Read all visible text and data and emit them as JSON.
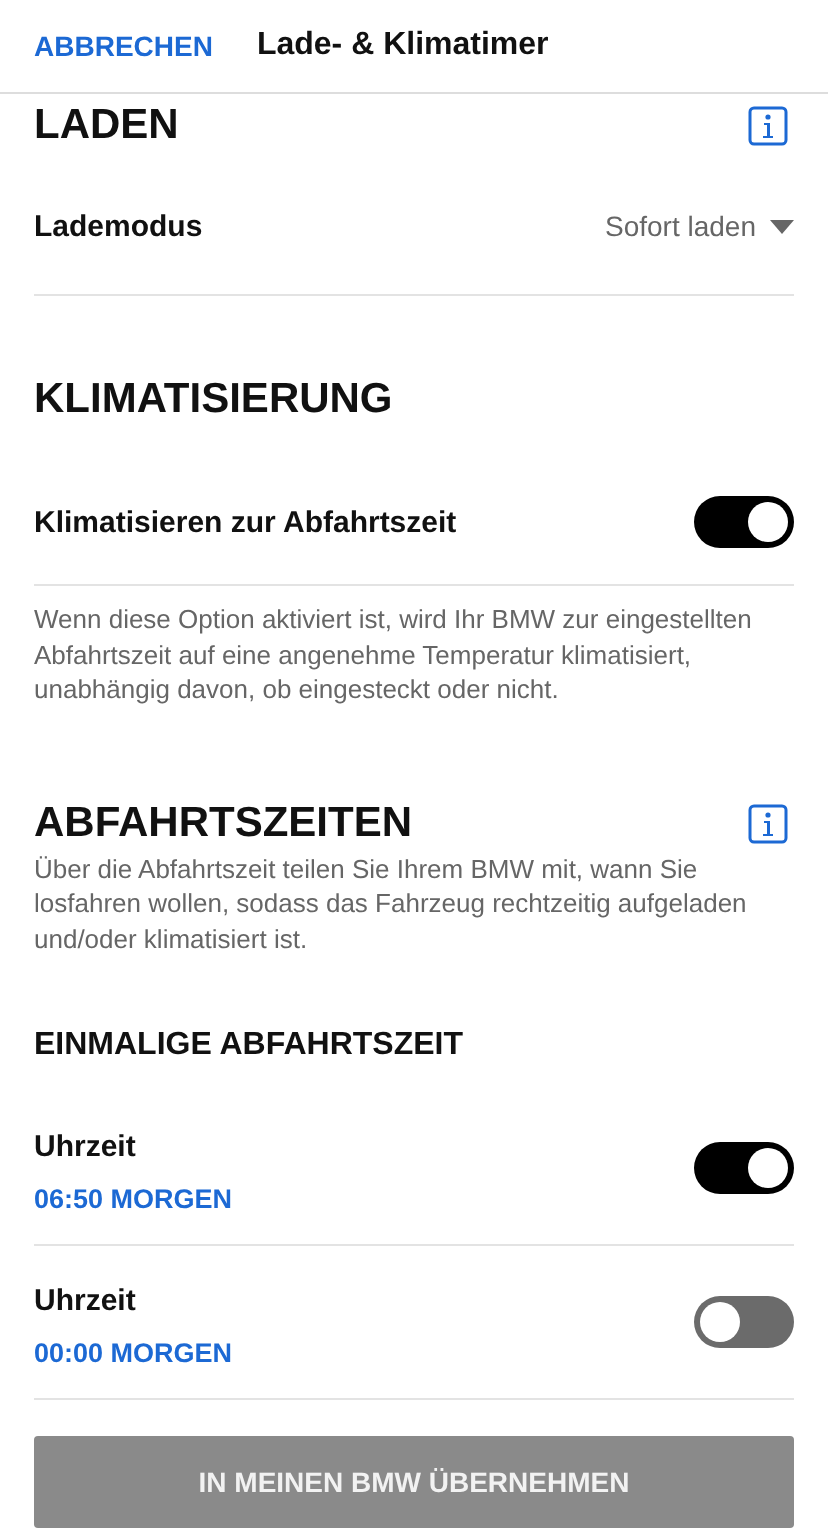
{
  "header": {
    "cancel": "ABBRECHEN",
    "title": "Lade- & Klimatimer"
  },
  "charging": {
    "heading": "LADEN",
    "mode_label": "Lademodus",
    "mode_value": "Sofort laden"
  },
  "climate": {
    "heading": "KLIMATISIERUNG",
    "toggle_label": "Klimatisieren zur Abfahrtszeit",
    "on": true,
    "description": "Wenn diese Option aktiviert ist, wird Ihr BMW zur eingestellten Abfahrtszeit auf eine angenehme Temperatur klimatisiert, unabhängig davon, ob eingesteckt oder nicht."
  },
  "departures": {
    "heading": "ABFAHRTSZEITEN",
    "description": "Über die Abfahrtszeit teilen Sie Ihrem BMW mit, wann Sie losfahren wollen, sodass das Fahrzeug rechtzeitig aufgeladen und/oder klimatisiert ist.",
    "subheading": "EINMALIGE ABFAHRTSZEIT",
    "timers": [
      {
        "label": "Uhrzeit",
        "time": "06:50 MORGEN",
        "on": true
      },
      {
        "label": "Uhrzeit",
        "time": "00:00 MORGEN",
        "on": false
      }
    ]
  },
  "apply_button": {
    "label": "IN MEINEN BMW ÜBERNEHMEN",
    "disabled": true
  }
}
